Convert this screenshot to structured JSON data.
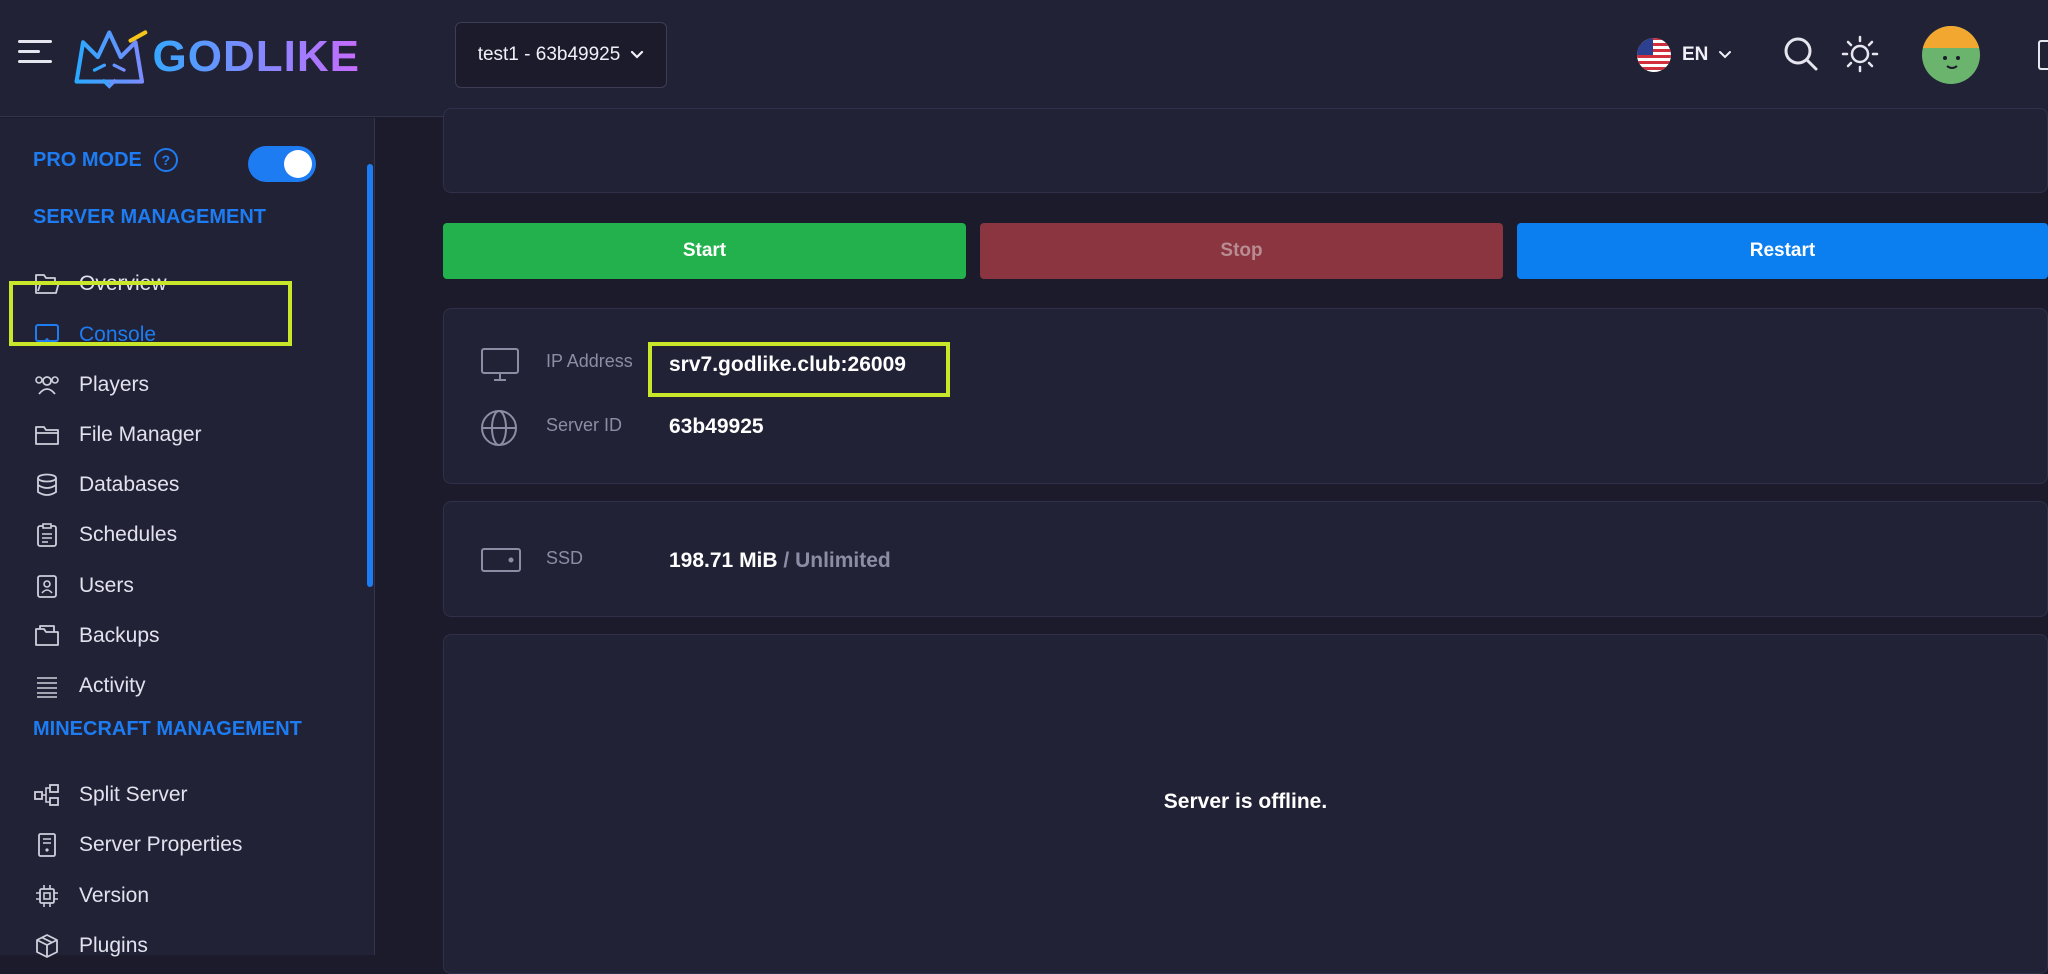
{
  "header": {
    "logo_text": "GODLIKE",
    "server_selector": "test1 - 63b49925",
    "language": "EN"
  },
  "sidebar": {
    "pro_mode_label": "PRO MODE",
    "pro_mode_enabled": true,
    "sections": [
      {
        "title": "SERVER MANAGEMENT",
        "items": [
          {
            "label": "Overview",
            "icon": "folder-open-icon"
          },
          {
            "label": "Console",
            "icon": "console-icon",
            "active": true
          },
          {
            "label": "Players",
            "icon": "players-icon"
          },
          {
            "label": "File Manager",
            "icon": "folder-icon"
          },
          {
            "label": "Databases",
            "icon": "database-icon"
          },
          {
            "label": "Schedules",
            "icon": "clipboard-icon"
          },
          {
            "label": "Users",
            "icon": "user-badge-icon"
          },
          {
            "label": "Backups",
            "icon": "backups-icon"
          },
          {
            "label": "Activity",
            "icon": "list-icon"
          }
        ]
      },
      {
        "title": "MINECRAFT MANAGEMENT",
        "items": [
          {
            "label": "Split Server",
            "icon": "split-icon"
          },
          {
            "label": "Server Properties",
            "icon": "properties-icon"
          },
          {
            "label": "Version",
            "icon": "chip-icon"
          },
          {
            "label": "Plugins",
            "icon": "box-icon"
          }
        ]
      }
    ]
  },
  "controls": {
    "start": "Start",
    "stop": "Stop",
    "restart": "Restart"
  },
  "server_info": {
    "ip_label": "IP Address",
    "ip_value": "srv7.godlike.club:26009",
    "id_label": "Server ID",
    "id_value": "63b49925",
    "ssd_label": "SSD",
    "ssd_used": "198.71 MiB",
    "ssd_separator": "/",
    "ssd_limit": "Unlimited"
  },
  "console": {
    "status_message": "Server is offline."
  },
  "colors": {
    "accent": "#1d7cf2",
    "start": "#22b14c",
    "stop": "#8a3540",
    "restart": "#0b7ff0",
    "highlight": "#c8e62a"
  }
}
